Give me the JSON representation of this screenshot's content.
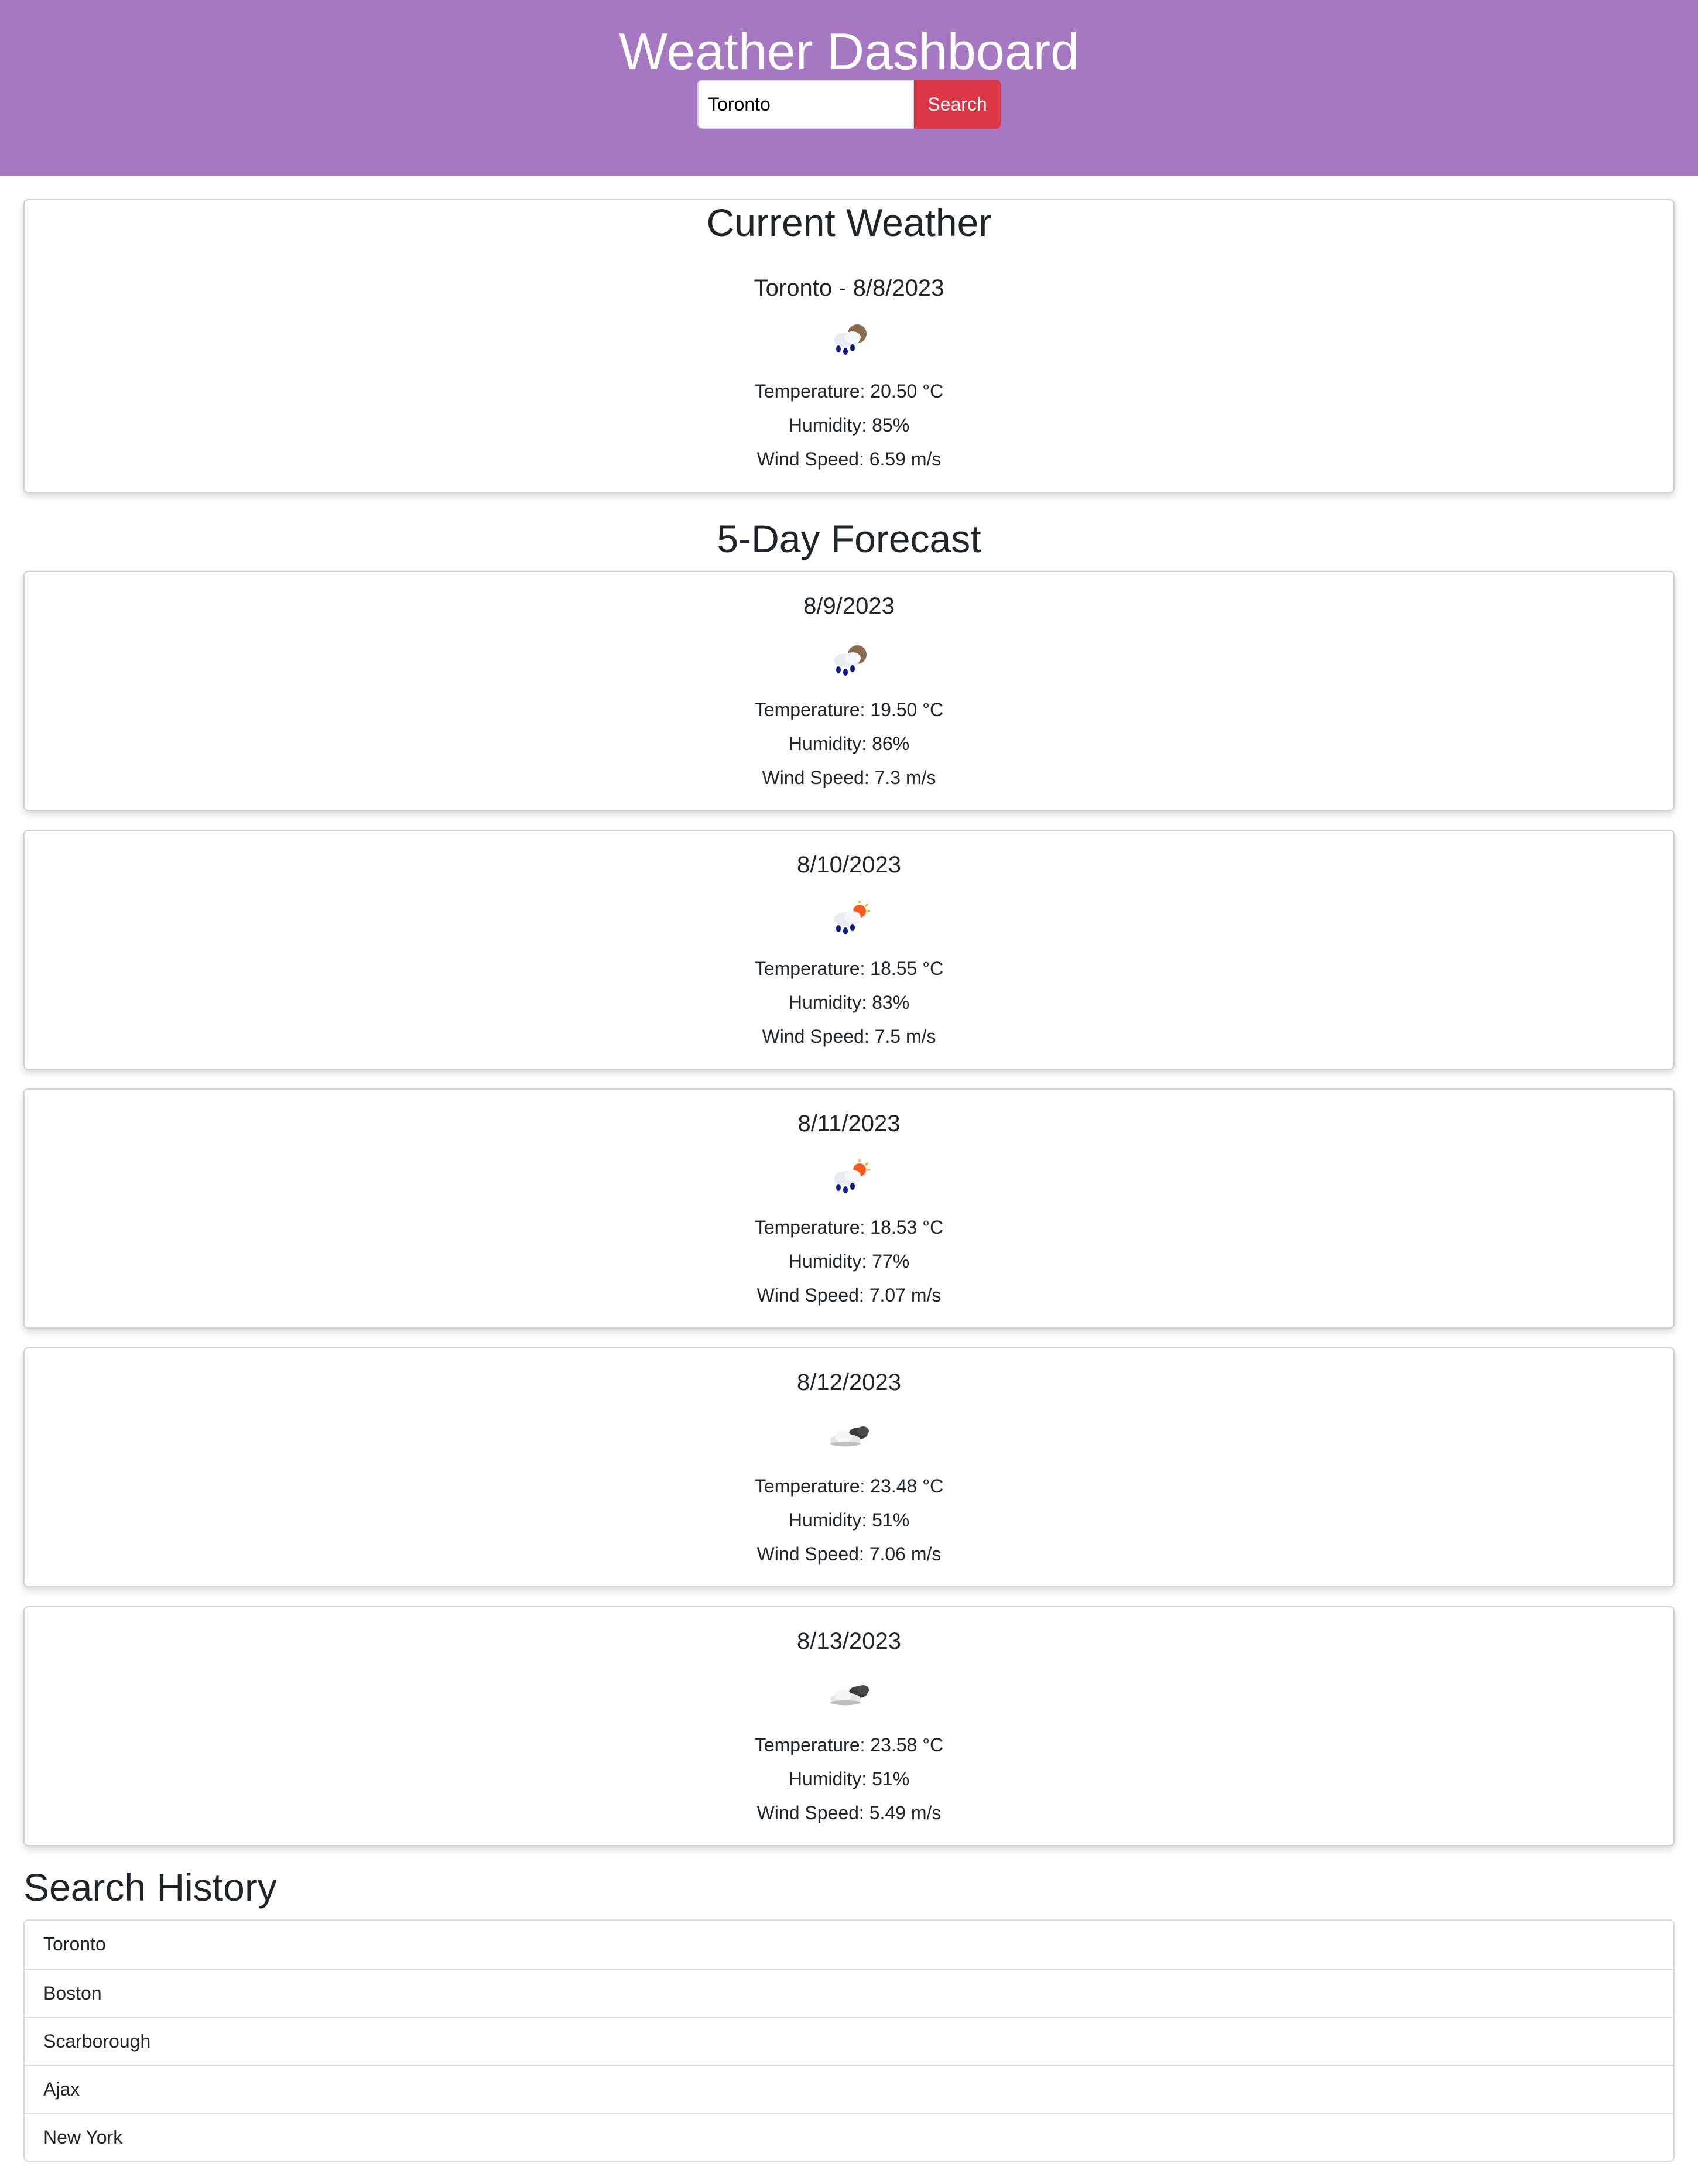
{
  "header": {
    "title": "Weather Dashboard",
    "search_value": "Toronto",
    "search_button_label": "Search",
    "background_color": "#a678c1",
    "button_color": "#dc3545"
  },
  "current": {
    "heading": "Current Weather",
    "subtitle": "Toronto - 8/8/2023",
    "icon": "rain-cloud-icon",
    "temperature": "Temperature: 20.50 °C",
    "humidity": "Humidity: 85%",
    "wind": "Wind Speed: 6.59 m/s"
  },
  "forecast": {
    "heading": "5-Day Forecast",
    "days": [
      {
        "date": "8/9/2023",
        "icon": "rain-cloud-icon",
        "temperature": "Temperature: 19.50 °C",
        "humidity": "Humidity: 86%",
        "wind": "Wind Speed: 7.3 m/s"
      },
      {
        "date": "8/10/2023",
        "icon": "rain-sun-icon",
        "temperature": "Temperature: 18.55 °C",
        "humidity": "Humidity: 83%",
        "wind": "Wind Speed: 7.5 m/s"
      },
      {
        "date": "8/11/2023",
        "icon": "rain-sun-icon",
        "temperature": "Temperature: 18.53 °C",
        "humidity": "Humidity: 77%",
        "wind": "Wind Speed: 7.07 m/s"
      },
      {
        "date": "8/12/2023",
        "icon": "broken-clouds-icon",
        "temperature": "Temperature: 23.48 °C",
        "humidity": "Humidity: 51%",
        "wind": "Wind Speed: 7.06 m/s"
      },
      {
        "date": "8/13/2023",
        "icon": "broken-clouds-icon",
        "temperature": "Temperature: 23.58 °C",
        "humidity": "Humidity: 51%",
        "wind": "Wind Speed: 5.49 m/s"
      }
    ]
  },
  "history": {
    "heading": "Search History",
    "items": [
      "Toronto",
      "Boston",
      "Scarborough",
      "Ajax",
      "New York"
    ]
  }
}
